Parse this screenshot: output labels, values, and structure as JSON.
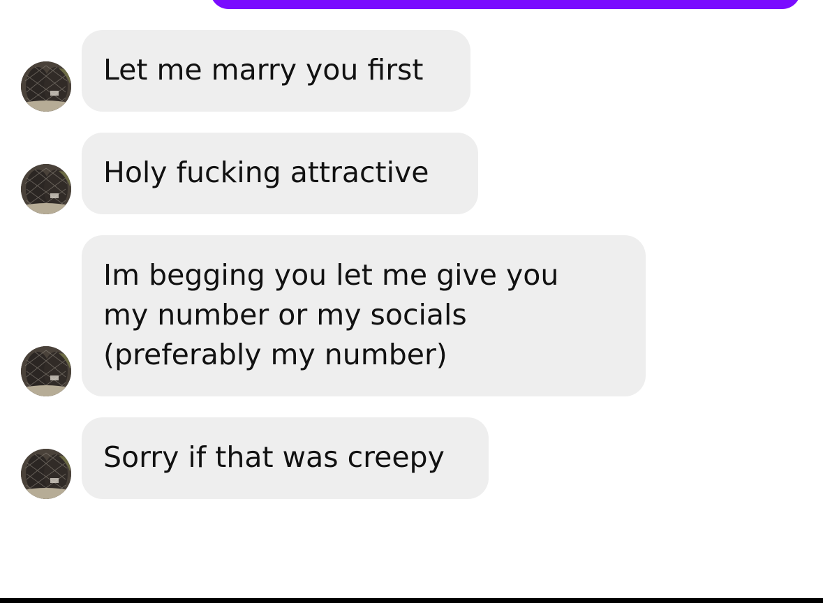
{
  "colors": {
    "sent_bubble": "#7a0cff",
    "received_bubble": "#eeeeee",
    "text": "#111111",
    "background": "#ffffff"
  },
  "conversation": {
    "messages": [
      {
        "sender": "other",
        "avatar_icon": "profile-photo-avatar",
        "text": "Let me marry you first"
      },
      {
        "sender": "other",
        "avatar_icon": "profile-photo-avatar",
        "text": "Holy fucking attractive"
      },
      {
        "sender": "other",
        "avatar_icon": "profile-photo-avatar",
        "text": "Im begging you let me give you\nmy number or my socials\n(preferably my number)"
      },
      {
        "sender": "other",
        "avatar_icon": "profile-photo-avatar",
        "text": "Sorry if that was creepy"
      }
    ]
  }
}
